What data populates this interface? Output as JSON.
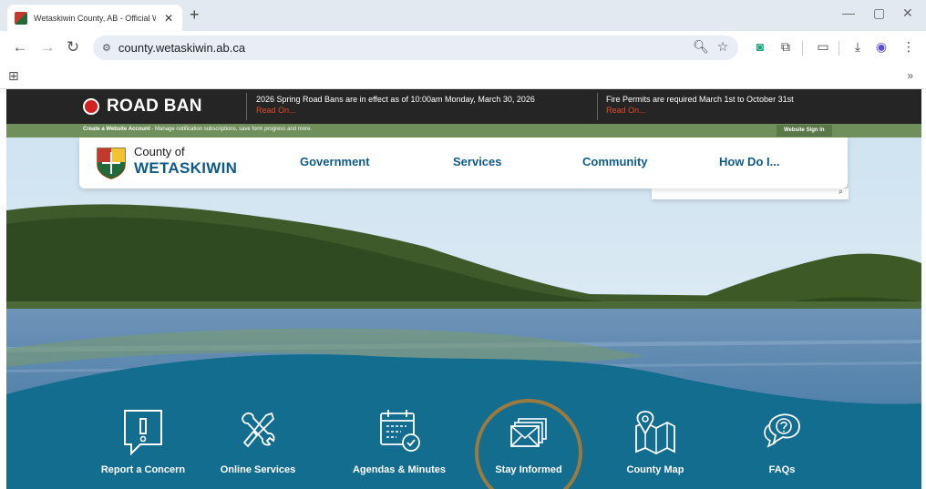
{
  "browser": {
    "tab_title": "Wetaskiwin County, AB - Official Website | Offi",
    "new_tab": "+",
    "url": "county.wetaskiwin.ab.ca",
    "bookmarks_more": "»"
  },
  "alerts": {
    "road_ban": "ROAD BAN",
    "alert1_text": "2026 Spring Road Bans are in effect as of 10:00am Monday, March 30, 2026",
    "alert1_link": "Read On...",
    "alert2_text": "Fire Permits are required March 1st to October 31st",
    "alert2_link": "Read On..."
  },
  "account_bar": {
    "bold": "Create a Website Account",
    "message": " - Manage notification subscriptions, save form progress and more.",
    "signin": "Website Sign In"
  },
  "header": {
    "logo_line1": "County of",
    "logo_line2": "WETASKIWIN",
    "nav": [
      "Government",
      "Services",
      "Community",
      "How Do I..."
    ]
  },
  "quick_links": [
    {
      "label": "Report a Concern",
      "icon": "report-concern-icon"
    },
    {
      "label": "Online Services",
      "icon": "tools-icon"
    },
    {
      "label": "Agendas & Minutes",
      "icon": "calendar-check-icon"
    },
    {
      "label": "Stay Informed",
      "icon": "envelopes-icon"
    },
    {
      "label": "County Map",
      "icon": "map-pin-icon"
    },
    {
      "label": "FAQs",
      "icon": "question-bubble-icon"
    }
  ],
  "colors": {
    "brand_blue": "#0f5b86",
    "water_band": "#136d8f",
    "road_ban_red": "#d32020",
    "green_bar": "#6f8f5b",
    "highlight_ring": "#9b7a3f"
  }
}
